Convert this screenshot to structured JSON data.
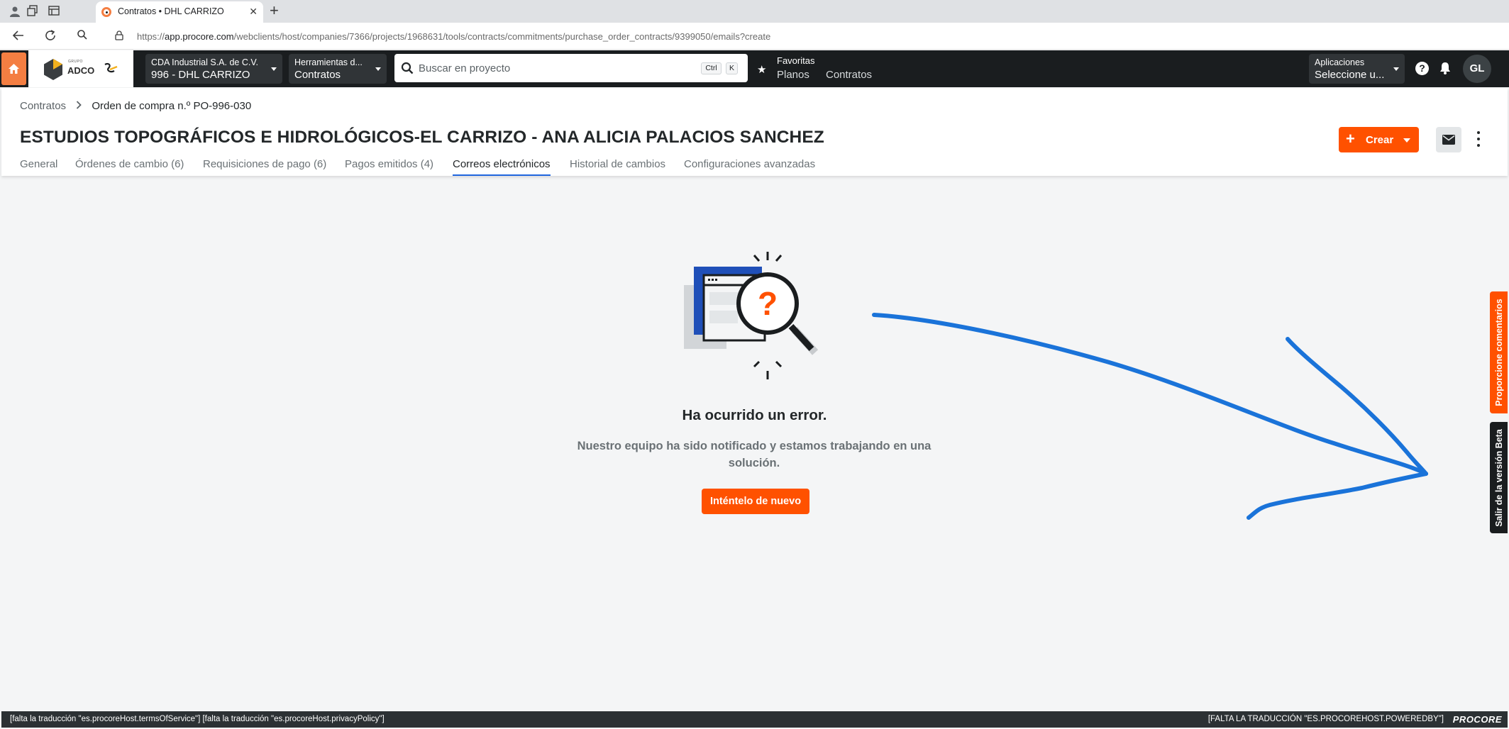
{
  "browser": {
    "tab_title": "Contratos • DHL CARRIZO",
    "url_prefix": "https://",
    "url_host": "app.procore.com",
    "url_path": "/webclients/host/companies/7366/projects/1968631/tools/contracts/commitments/purchase_order_contracts/9399050/emails?create"
  },
  "header": {
    "logo_small": "GRUPO",
    "logo_text": "ADCO",
    "company_label": "CDA Industrial S.A. de C.V.",
    "project_label": "996 - DHL CARRIZO",
    "tools_label": "Herramientas d...",
    "tools_value": "Contratos",
    "search_placeholder": "Buscar en proyecto",
    "kbd_ctrl": "Ctrl",
    "kbd_k": "K",
    "favorites_title": "Favoritas",
    "favorites": [
      "Planos",
      "Contratos"
    ],
    "apps_label": "Aplicaciones",
    "apps_value": "Seleccione u...",
    "help": "?",
    "avatar_initials": "GL"
  },
  "page": {
    "breadcrumb_root": "Contratos",
    "breadcrumb_current": "Orden de compra n.º PO-996-030",
    "title": "ESTUDIOS TOPOGRÁFICOS E HIDROLÓGICOS-EL CARRIZO - ANA ALICIA PALACIOS SANCHEZ",
    "create_label": "Crear",
    "tabs": [
      "General",
      "Órdenes de cambio (6)",
      "Requisiciones de pago (6)",
      "Pagos emitidos (4)",
      "Correos electrónicos",
      "Historial de cambios",
      "Configuraciones avanzadas"
    ],
    "active_tab": "Correos electrónicos"
  },
  "error": {
    "title": "Ha ocurrido un error.",
    "message": "Nuestro equipo ha sido notificado y estamos trabajando en una solución.",
    "retry_label": "Inténtelo de nuevo"
  },
  "side": {
    "feedback": "Proporcione comentarios",
    "beta_exit": "Salir de la versión Beta"
  },
  "footer": {
    "left": "[falta la traducción \"es.procoreHost.termsOfService\"]  [falta la traducción \"es.procoreHost.privacyPolicy\"]",
    "right": "[FALTA LA TRADUCCIÓN \"ES.PROCOREHOST.POWEREDBY\"]",
    "logo": "PROCORE"
  },
  "colors": {
    "brand_orange": "#ff5100",
    "header_dark": "#1a1d1f",
    "tab_underline": "#2066df",
    "annotation_blue": "#1a73d9"
  }
}
